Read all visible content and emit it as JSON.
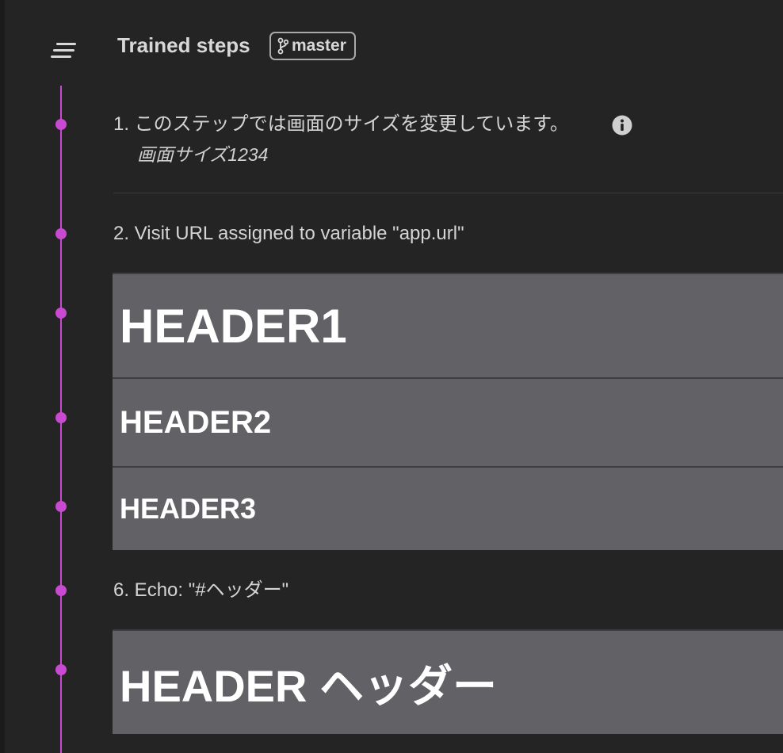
{
  "panel": {
    "title": "Trained steps",
    "branch": "master"
  },
  "steps": [
    {
      "text": "1. このステップでは画面のサイズを変更しています。",
      "subtext": "画面サイズ1234"
    },
    {
      "text": "2. Visit URL assigned to variable \"app.url\""
    },
    {
      "header": "HEADER1"
    },
    {
      "header": "HEADER2"
    },
    {
      "header": "HEADER3"
    },
    {
      "text": "6. Echo: \"#ヘッダー\""
    },
    {
      "header": "HEADER ヘッダー"
    }
  ],
  "colors": {
    "background": "#242424",
    "timeline": "#c84ad0",
    "header_box": "#626166",
    "text": "#d4d4d4"
  },
  "icons": {
    "menu": "menu-lines-icon",
    "branch": "git-branch-icon",
    "info": "info-icon"
  }
}
